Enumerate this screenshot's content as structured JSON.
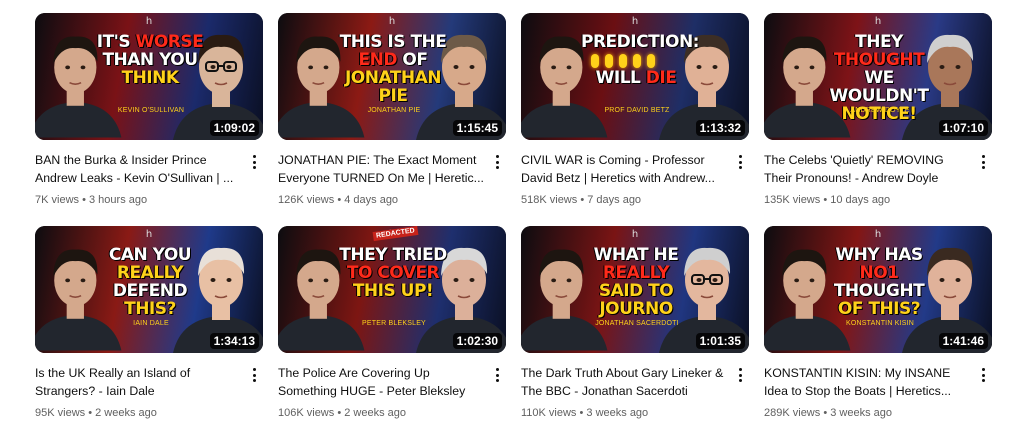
{
  "videos": [
    {
      "headline_parts": [
        [
          "IT'S ",
          ""
        ],
        [
          "WORSE",
          "hl"
        ],
        [
          " THAN YOU ",
          ""
        ],
        [
          "THINK",
          "hly"
        ]
      ],
      "guest_caption": "KEVIN O'SULLIVAN",
      "duration": "1:09:02",
      "title": "BAN the Burka & Insider Prince Andrew Leaks - Kevin O'Sullivan | ...",
      "views": "7K views",
      "age": "3 hours ago",
      "bg": [
        "#7a1216",
        "#1b2a6b"
      ],
      "right_skin": "#d9b59a",
      "right_hair": "#2a1b12",
      "right_glasses": true
    },
    {
      "headline_parts": [
        [
          "THIS IS ",
          ""
        ],
        [
          "THE ",
          ""
        ],
        [
          "END",
          "hl"
        ],
        [
          " OF ",
          ""
        ],
        [
          "JONATHAN PIE",
          "hly"
        ]
      ],
      "guest_caption": "JONATHAN PIE",
      "duration": "1:15:45",
      "title": "JONATHAN PIE: The Exact Moment Everyone TURNED On Me | Heretic...",
      "views": "126K views",
      "age": "4 days ago",
      "bg": [
        "#8c1a14",
        "#243a7a"
      ],
      "right_skin": "#d7a98a",
      "right_hair": "#6d5a48",
      "right_glasses": false
    },
    {
      "headline_parts": [
        [
          "PREDICTION: ",
          ""
        ],
        [
          "",
          "coins"
        ],
        [
          "WILL ",
          ""
        ],
        [
          "DIE",
          "hl"
        ]
      ],
      "guest_caption": "PROF DAVID BETZ",
      "duration": "1:13:32",
      "title": "CIVIL WAR is Coming - Professor David Betz | Heretics with Andrew...",
      "views": "518K views",
      "age": "7 days ago",
      "bg": [
        "#6b0f12",
        "#1e2e66"
      ],
      "right_skin": "#e0b196",
      "right_hair": "#3c2e25",
      "right_glasses": false
    },
    {
      "headline_parts": [
        [
          "THEY ",
          ""
        ],
        [
          "THOUGHT",
          "hl"
        ],
        [
          " WE WOULDN'T ",
          ""
        ],
        [
          "NOTICE!",
          "hly"
        ]
      ],
      "guest_caption": "ANDREW DOYLE",
      "duration": "1:07:10",
      "title": "The Celebs 'Quietly' REMOVING Their Pronouns! - Andrew Doyle",
      "views": "135K views",
      "age": "10 days ago",
      "bg": [
        "#7e1317",
        "#2a3a86"
      ],
      "right_skin": "#a9775a",
      "right_hair": "#cfcfcf",
      "right_glasses": false
    },
    {
      "headline_parts": [
        [
          "CAN YOU ",
          ""
        ],
        [
          "REALLY",
          "hly"
        ],
        [
          " DEFEND ",
          ""
        ],
        [
          "THIS?",
          "hly"
        ]
      ],
      "guest_caption": "IAIN DALE",
      "duration": "1:34:13",
      "title": "Is the UK Really an Island of Strangers? - Iain Dale",
      "views": "95K views",
      "age": "2 weeks ago",
      "bg": [
        "#8a1a15",
        "#1f3a8a"
      ],
      "right_skin": "#e8c0a4",
      "right_hair": "#e8e0d8",
      "right_glasses": false
    },
    {
      "headline_parts": [
        [
          "THEY TRIED ",
          ""
        ],
        [
          "TO ",
          "hl"
        ],
        [
          "COVER",
          "hl"
        ],
        [
          " THIS UP!",
          "hly"
        ]
      ],
      "guest_caption": "PETER BLEKSLEY",
      "redacted": "REDACTED",
      "duration": "1:02:30",
      "title": "The Police Are Covering Up Something HUGE - Peter Bleksley",
      "views": "106K views",
      "age": "2 weeks ago",
      "bg": [
        "#7d1612",
        "#1e2f6e"
      ],
      "right_skin": "#dcb09a",
      "right_hair": "#d8d8d8",
      "right_glasses": false
    },
    {
      "headline_parts": [
        [
          "WHAT HE ",
          ""
        ],
        [
          "REALLY",
          "hl"
        ],
        [
          " SAID ",
          "hly"
        ],
        [
          "TO JOURNO",
          "hly"
        ]
      ],
      "guest_caption": "JONATHAN SACERDOTI",
      "duration": "1:01:35",
      "title": "The Dark Truth About Gary Lineker & The BBC - Jonathan Sacerdoti",
      "views": "110K views",
      "age": "3 weeks ago",
      "bg": [
        "#7a1414",
        "#203680"
      ],
      "right_skin": "#e3b79e",
      "right_hair": "#cfcfcf",
      "right_glasses": true
    },
    {
      "headline_parts": [
        [
          "WHY HAS ",
          ""
        ],
        [
          "NO1",
          "hl"
        ],
        [
          " THOUGHT ",
          ""
        ],
        [
          "OF THIS?",
          "hly"
        ]
      ],
      "guest_caption": "KONSTANTIN KISIN",
      "duration": "1:41:46",
      "title": "KONSTANTIN KISIN: My INSANE Idea to Stop the Boats | Heretics...",
      "views": "289K views",
      "age": "3 weeks ago",
      "bg": [
        "#831614",
        "#223a88"
      ],
      "right_skin": "#e0b29a",
      "right_hair": "#3a2a20",
      "right_glasses": false
    }
  ],
  "separator": " • ",
  "brand_mark": "h",
  "colors": {
    "accent_red": "#ff2a1a",
    "accent_yellow": "#ffd21a",
    "meta_gray": "#606060",
    "title_text": "#0f0f0f"
  },
  "icons": {
    "menu": "more-vert-icon"
  }
}
